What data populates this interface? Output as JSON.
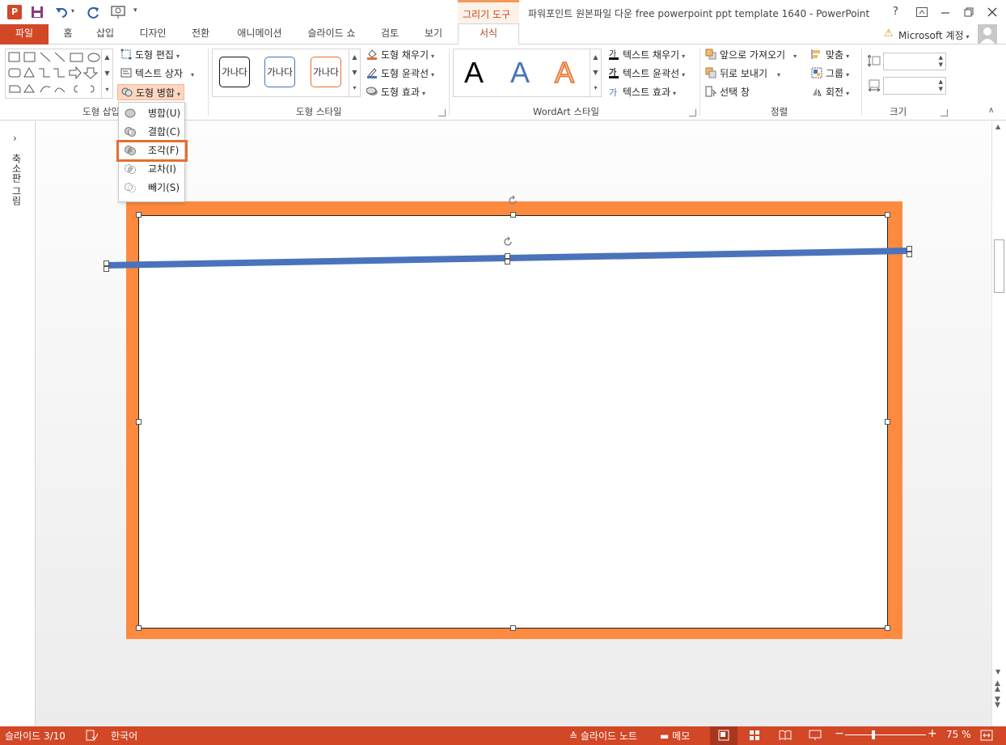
{
  "window": {
    "title": "파워포인트 원본파일 다운 free powerpoint ppt template 1640 - PowerPoint",
    "contextual_tab_group": "그리기 도구",
    "help": "?",
    "account": "Microsoft 계정"
  },
  "tabs": [
    {
      "label": "파일"
    },
    {
      "label": "홈"
    },
    {
      "label": "삽입"
    },
    {
      "label": "디자인"
    },
    {
      "label": "전환"
    },
    {
      "label": "애니메이션"
    },
    {
      "label": "슬라이드 쇼"
    },
    {
      "label": "검토"
    },
    {
      "label": "보기"
    },
    {
      "label": "서식"
    }
  ],
  "ribbon": {
    "insert_shapes": {
      "edit_shape": "도형 편집",
      "text_box": "텍스트 상자",
      "merge_shapes": "도형 병합",
      "group_label": "도형 삽입"
    },
    "shape_styles": {
      "samples": [
        "가나다",
        "가나다",
        "가나다"
      ],
      "fill": "도형 채우기",
      "outline": "도형 윤곽선",
      "effects": "도형 효과",
      "group_label": "도형 스타일"
    },
    "wordart": {
      "letter": "A",
      "text_fill": "텍스트 채우기",
      "text_outline": "텍스트 윤곽선",
      "text_effects": "텍스트 효과",
      "group_label": "WordArt 스타일"
    },
    "arrange": {
      "bring_forward": "앞으로 가져오기",
      "send_backward": "뒤로 보내기",
      "selection_pane": "선택 창",
      "align": "맞춤",
      "group": "그룹",
      "rotate": "회전",
      "group_label": "정렬"
    },
    "size": {
      "group_label": "크기"
    }
  },
  "merge_menu": {
    "items": [
      {
        "label": "병합(U)"
      },
      {
        "label": "결합(C)"
      },
      {
        "label": "조각(F)"
      },
      {
        "label": "교차(I)"
      },
      {
        "label": "빼기(S)"
      }
    ],
    "highlighted": "조각(F)"
  },
  "left_pane": {
    "label": "축소판 그림"
  },
  "status": {
    "slide": "슬라이드 3/10",
    "language": "한국어",
    "notes": "슬라이드 노트",
    "comments": "메모",
    "zoom": "75 %"
  },
  "colors": {
    "accent": "#d24726",
    "slide_frame": "#fd8a3f",
    "line": "#4a73bb",
    "highlight_box": "#e5702e"
  }
}
